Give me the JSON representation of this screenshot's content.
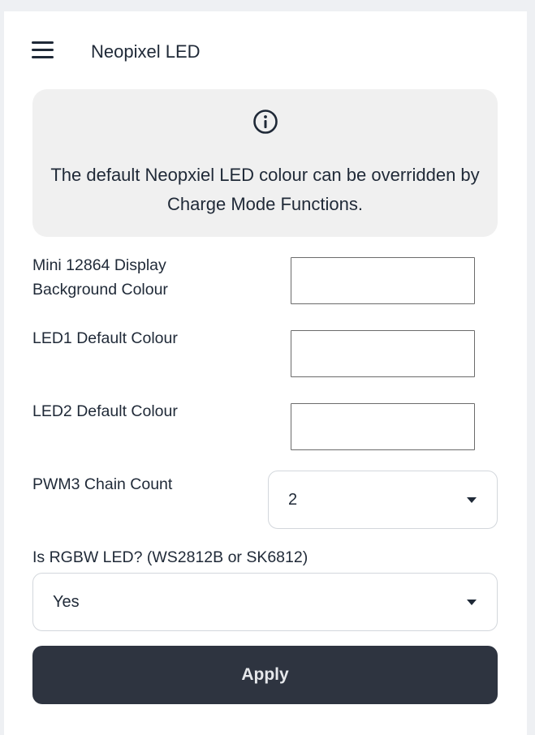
{
  "header": {
    "title": "Neopixel LED",
    "menu_icon": "hamburger-menu-icon"
  },
  "info": {
    "icon": "info-circle-icon",
    "text": "The default Neopxiel LED colour can be overridden by Charge Mode Functions."
  },
  "fields": {
    "display_bg": {
      "label_line1": "Mini 12864 Display",
      "label_line2": "Background Colour",
      "value": ""
    },
    "led1": {
      "label": "LED1 Default Colour",
      "value": ""
    },
    "led2": {
      "label": "LED2 Default Colour",
      "value": ""
    },
    "pwm3": {
      "label": "PWM3 Chain Count",
      "value": "2"
    },
    "rgbw": {
      "label": "Is RGBW LED? (WS2812B or SK6812)",
      "value": "Yes"
    }
  },
  "apply_label": "Apply",
  "colors": {
    "apply_bg": "#2e3440",
    "info_bg": "#f0f0f0",
    "text": "#1f2937"
  }
}
